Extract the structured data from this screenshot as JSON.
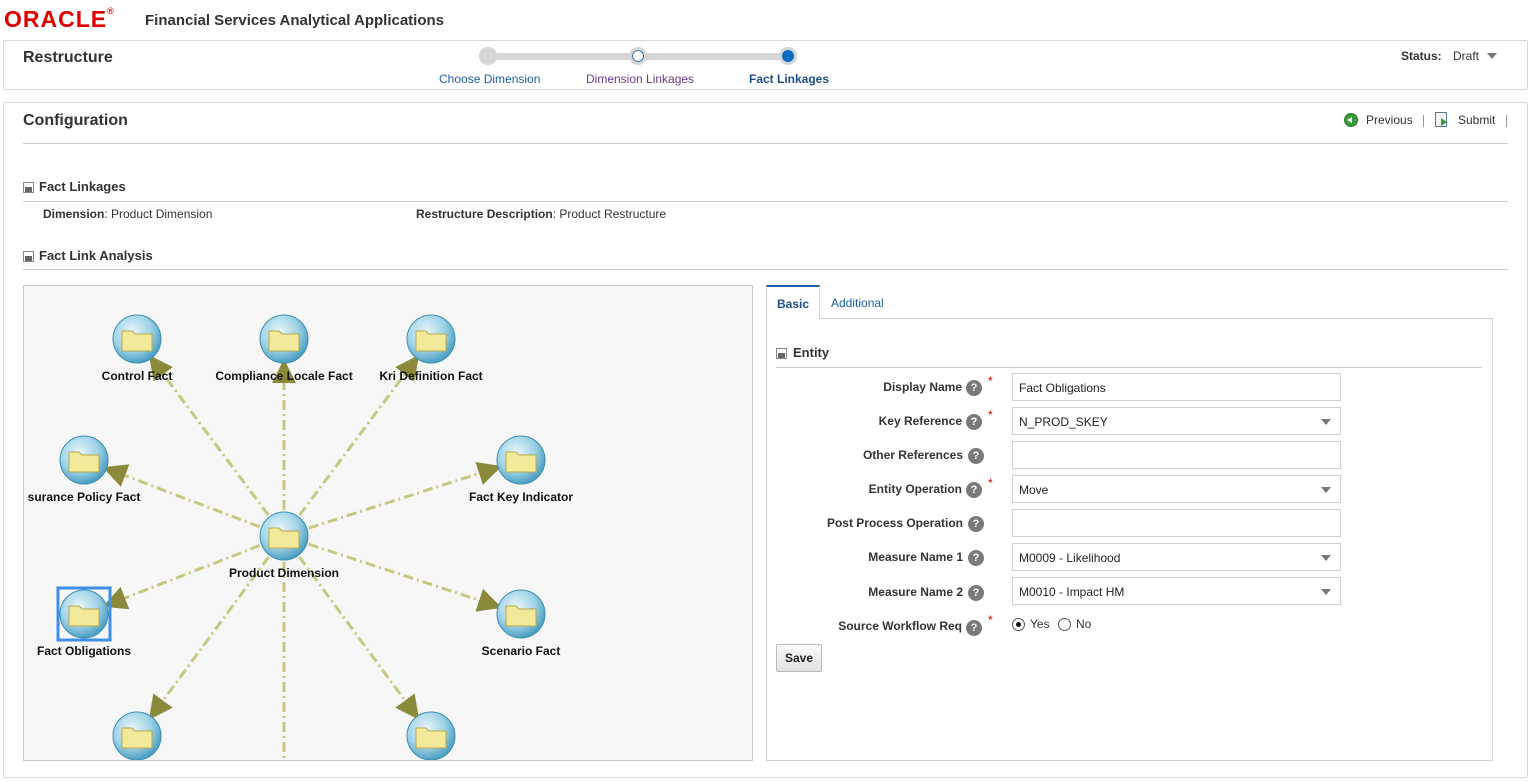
{
  "header": {
    "logo_text": "ORACLE",
    "app_title": "Financial Services Analytical Applications"
  },
  "train": {
    "page_title": "Restructure",
    "steps": [
      {
        "label": "Choose Dimension",
        "state": "visited"
      },
      {
        "label": "Dimension Linkages",
        "state": "visited"
      },
      {
        "label": "Fact Linkages",
        "state": "current"
      }
    ],
    "status_label": "Status:",
    "status_value": "Draft"
  },
  "configuration": {
    "title": "Configuration",
    "previous_label": "Previous",
    "submit_label": "Submit"
  },
  "fact_linkages": {
    "title": "Fact Linkages",
    "dimension_label": "Dimension",
    "dimension_value": ": Product Dimension",
    "description_label": "Restructure Description",
    "description_value": ": Product Restructure"
  },
  "fact_link_analysis": {
    "title": "Fact Link Analysis",
    "center_node": "Product Dimension",
    "nodes": [
      "Control Fact",
      "Compliance Locale Fact",
      "Kri Definition Fact",
      "surance Policy Fact",
      "Fact Key Indicator",
      "Fact Obligations",
      "Scenario Fact"
    ],
    "selected_node": "Fact Obligations"
  },
  "tabs": {
    "basic": "Basic",
    "additional": "Additional"
  },
  "entity_form": {
    "title": "Entity",
    "fields": {
      "display_name": {
        "label": "Display Name",
        "value": "Fact Obligations",
        "required": true
      },
      "key_reference": {
        "label": "Key Reference",
        "value": "N_PROD_SKEY",
        "required": true
      },
      "other_references": {
        "label": "Other References",
        "value": ""
      },
      "entity_operation": {
        "label": "Entity Operation",
        "value": "Move",
        "required": true
      },
      "post_process_operation": {
        "label": "Post Process Operation",
        "value": ""
      },
      "measure_name_1": {
        "label": "Measure Name 1",
        "value": "M0009 - Likelihood"
      },
      "measure_name_2": {
        "label": "Measure Name 2",
        "value": "M0010 - Impact HM"
      },
      "source_workflow_req": {
        "label": "Source Workflow Req",
        "required": true,
        "options": [
          "Yes",
          "No"
        ],
        "selected": "Yes"
      }
    },
    "help_glyph": "?",
    "required_glyph": "*",
    "save_label": "Save"
  }
}
